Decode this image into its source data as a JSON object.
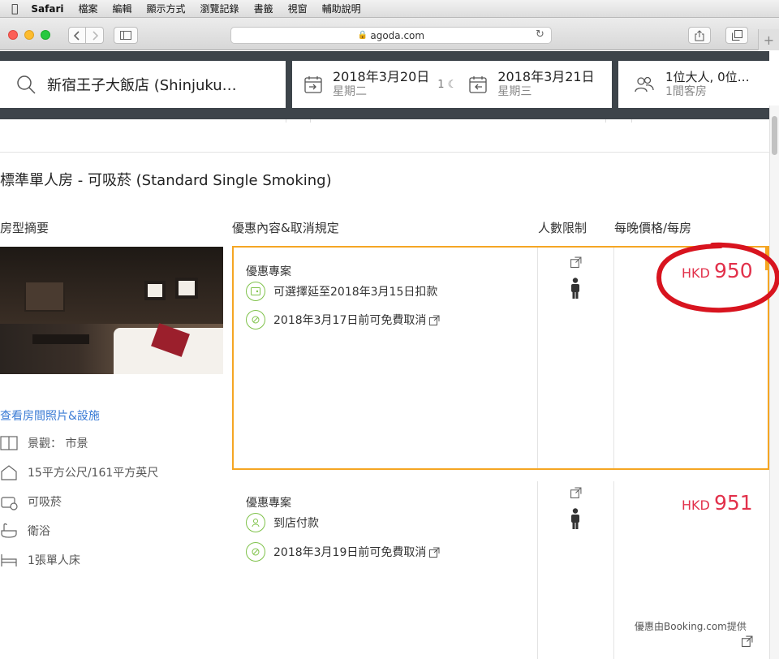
{
  "menubar": {
    "items": [
      "Safari",
      "檔案",
      "編輯",
      "顯示方式",
      "瀏覽記錄",
      "書籤",
      "視窗",
      "輔助說明"
    ]
  },
  "browser": {
    "address": "agoda.com"
  },
  "search": {
    "destination": "新宿王子大飯店 (Shinjuku…",
    "checkin_date": "2018年3月20日",
    "checkin_day": "星期二",
    "nights": "1",
    "checkout_date": "2018年3月21日",
    "checkout_day": "星期三",
    "guests": "1位大人, 0位…",
    "rooms": "1間客房"
  },
  "room": {
    "title": "標準單人房 - 可吸菸 (Standard Single Smoking)",
    "photos_link": "查看房間照片&設施",
    "amenities": [
      "景觀： 市景",
      "15平方公尺/161平方英尺",
      "可吸菸",
      "衛浴",
      "1張單人床"
    ]
  },
  "columns": {
    "room_summary": "房型摘要",
    "offers": "優惠內容&取消規定",
    "occupancy": "人數限制",
    "price": "每晚價格/每房"
  },
  "offers": [
    {
      "title": "優惠專案",
      "line1": "可選擇延至2018年3月15日扣款",
      "line2": "2018年3月17日前可免費取消",
      "currency": "HKD",
      "price": "950"
    },
    {
      "title": "優惠專案",
      "line1": "到店付款",
      "line2": "2018年3月19日前可免費取消",
      "currency": "HKD",
      "price": "951",
      "provider": "優惠由Booking.com提供"
    }
  ],
  "colors": {
    "price": "#e2314b",
    "highlight_border": "#f5a623",
    "annotation": "#d8141f",
    "link": "#3a7bd5",
    "header_bg": "#3d444a"
  }
}
